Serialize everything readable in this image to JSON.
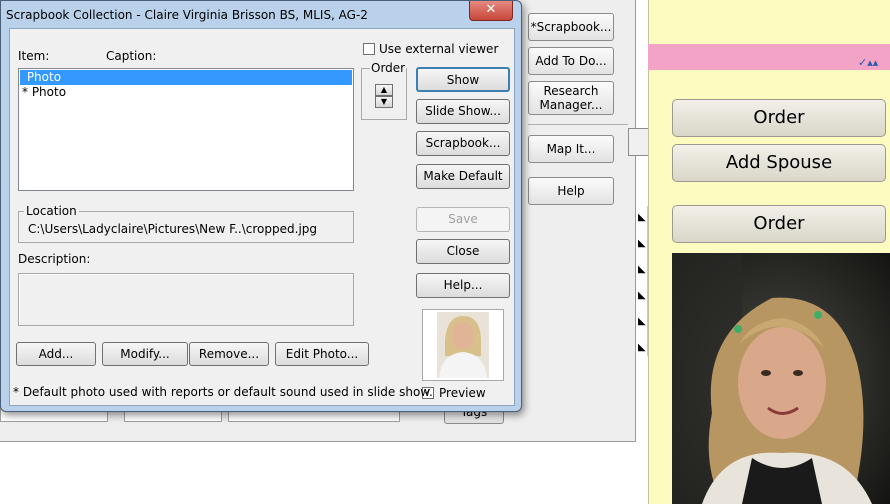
{
  "dialog": {
    "title": "Scrapbook Collection - Claire Virginia Brisson BS, MLIS, AG-2",
    "item_header": "Item:",
    "caption_header": "Caption:",
    "items": [
      " Photo",
      "* Photo"
    ],
    "use_external_viewer_label": "Use external viewer",
    "use_external_viewer_checked": false,
    "order_label": "Order",
    "location_label": "Location",
    "location_value": "C:\\Users\\Ladyclaire\\Pictures\\New F..\\cropped.jpg",
    "description_label": "Description:",
    "description_value": "",
    "buttons": {
      "show": "Show",
      "slide_show": "Slide Show...",
      "scrapbook": "Scrapbook...",
      "make_default": "Make Default",
      "save": "Save",
      "close": "Close",
      "help": "Help...",
      "add": "Add...",
      "modify": "Modify...",
      "remove": "Remove...",
      "edit_photo": "Edit Photo..."
    },
    "preview_label": "Preview",
    "preview_checked": true,
    "footnote": "* Default photo used with reports or default sound used in slide show."
  },
  "background": {
    "buttons": {
      "scrapbook": "*Scrapbook...",
      "add_todo": "Add To Do...",
      "research_line1": "Research",
      "research_line2": "Manager...",
      "map_it": "Map It...",
      "help": "Help"
    },
    "right_panel": {
      "order_1": "Order",
      "add_spouse": "Add Spouse",
      "order_2": "Order"
    },
    "tags_label": "Tags"
  },
  "colors": {
    "title_bar": "#b9d1ea",
    "close_button": "#c7463a",
    "selection": "#3399ff",
    "yellow_panel": "#fdfbc0",
    "pink_bar": "#f2a3c6"
  }
}
